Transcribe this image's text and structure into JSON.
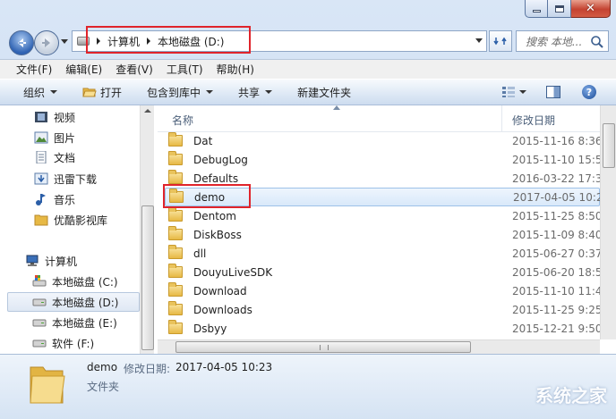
{
  "address": {
    "crumbs": [
      "计算机",
      "本地磁盘 (D:)"
    ],
    "search_placeholder": "搜索 本地..."
  },
  "menu": [
    "文件(F)",
    "编辑(E)",
    "查看(V)",
    "工具(T)",
    "帮助(H)"
  ],
  "commands": {
    "organize": "组织",
    "open": "打开",
    "include_library": "包含到库中",
    "share": "共享",
    "new_folder": "新建文件夹"
  },
  "nav": [
    {
      "label": "视频",
      "icon": "video-icon"
    },
    {
      "label": "图片",
      "icon": "picture-icon"
    },
    {
      "label": "文档",
      "icon": "document-icon"
    },
    {
      "label": "迅雷下载",
      "icon": "download-icon"
    },
    {
      "label": "音乐",
      "icon": "music-icon"
    },
    {
      "label": "优酷影视库",
      "icon": "folder-icon"
    },
    {
      "label": "计算机",
      "icon": "computer-icon"
    },
    {
      "label": "本地磁盘 (C:)",
      "icon": "drive-icon"
    },
    {
      "label": "本地磁盘 (D:)",
      "icon": "drive-icon"
    },
    {
      "label": "本地磁盘 (E:)",
      "icon": "drive-icon"
    },
    {
      "label": "软件 (F:)",
      "icon": "drive-icon"
    }
  ],
  "columns": {
    "name": "名称",
    "date": "修改日期"
  },
  "files": [
    {
      "name": "Dat",
      "date": "2015-11-16 8:36"
    },
    {
      "name": "DebugLog",
      "date": "2015-11-10 15:5"
    },
    {
      "name": "Defaults",
      "date": "2016-03-22 17:3"
    },
    {
      "name": "demo",
      "date": "2017-04-05 10:2"
    },
    {
      "name": "Dentom",
      "date": "2015-11-25 8:50"
    },
    {
      "name": "DiskBoss",
      "date": "2015-11-09 8:40"
    },
    {
      "name": "dll",
      "date": "2015-06-27 0:37"
    },
    {
      "name": "DouyuLiveSDK",
      "date": "2015-06-20 18:5"
    },
    {
      "name": "Download",
      "date": "2015-11-10 11:4"
    },
    {
      "name": "Downloads",
      "date": "2015-11-25 9:25"
    },
    {
      "name": "Dsbyy",
      "date": "2015-12-21 9:50"
    }
  ],
  "details": {
    "name": "demo",
    "date_label": "修改日期:",
    "date_value": "2017-04-05 10:23",
    "type": "文件夹",
    "watermark": "系统之家"
  }
}
